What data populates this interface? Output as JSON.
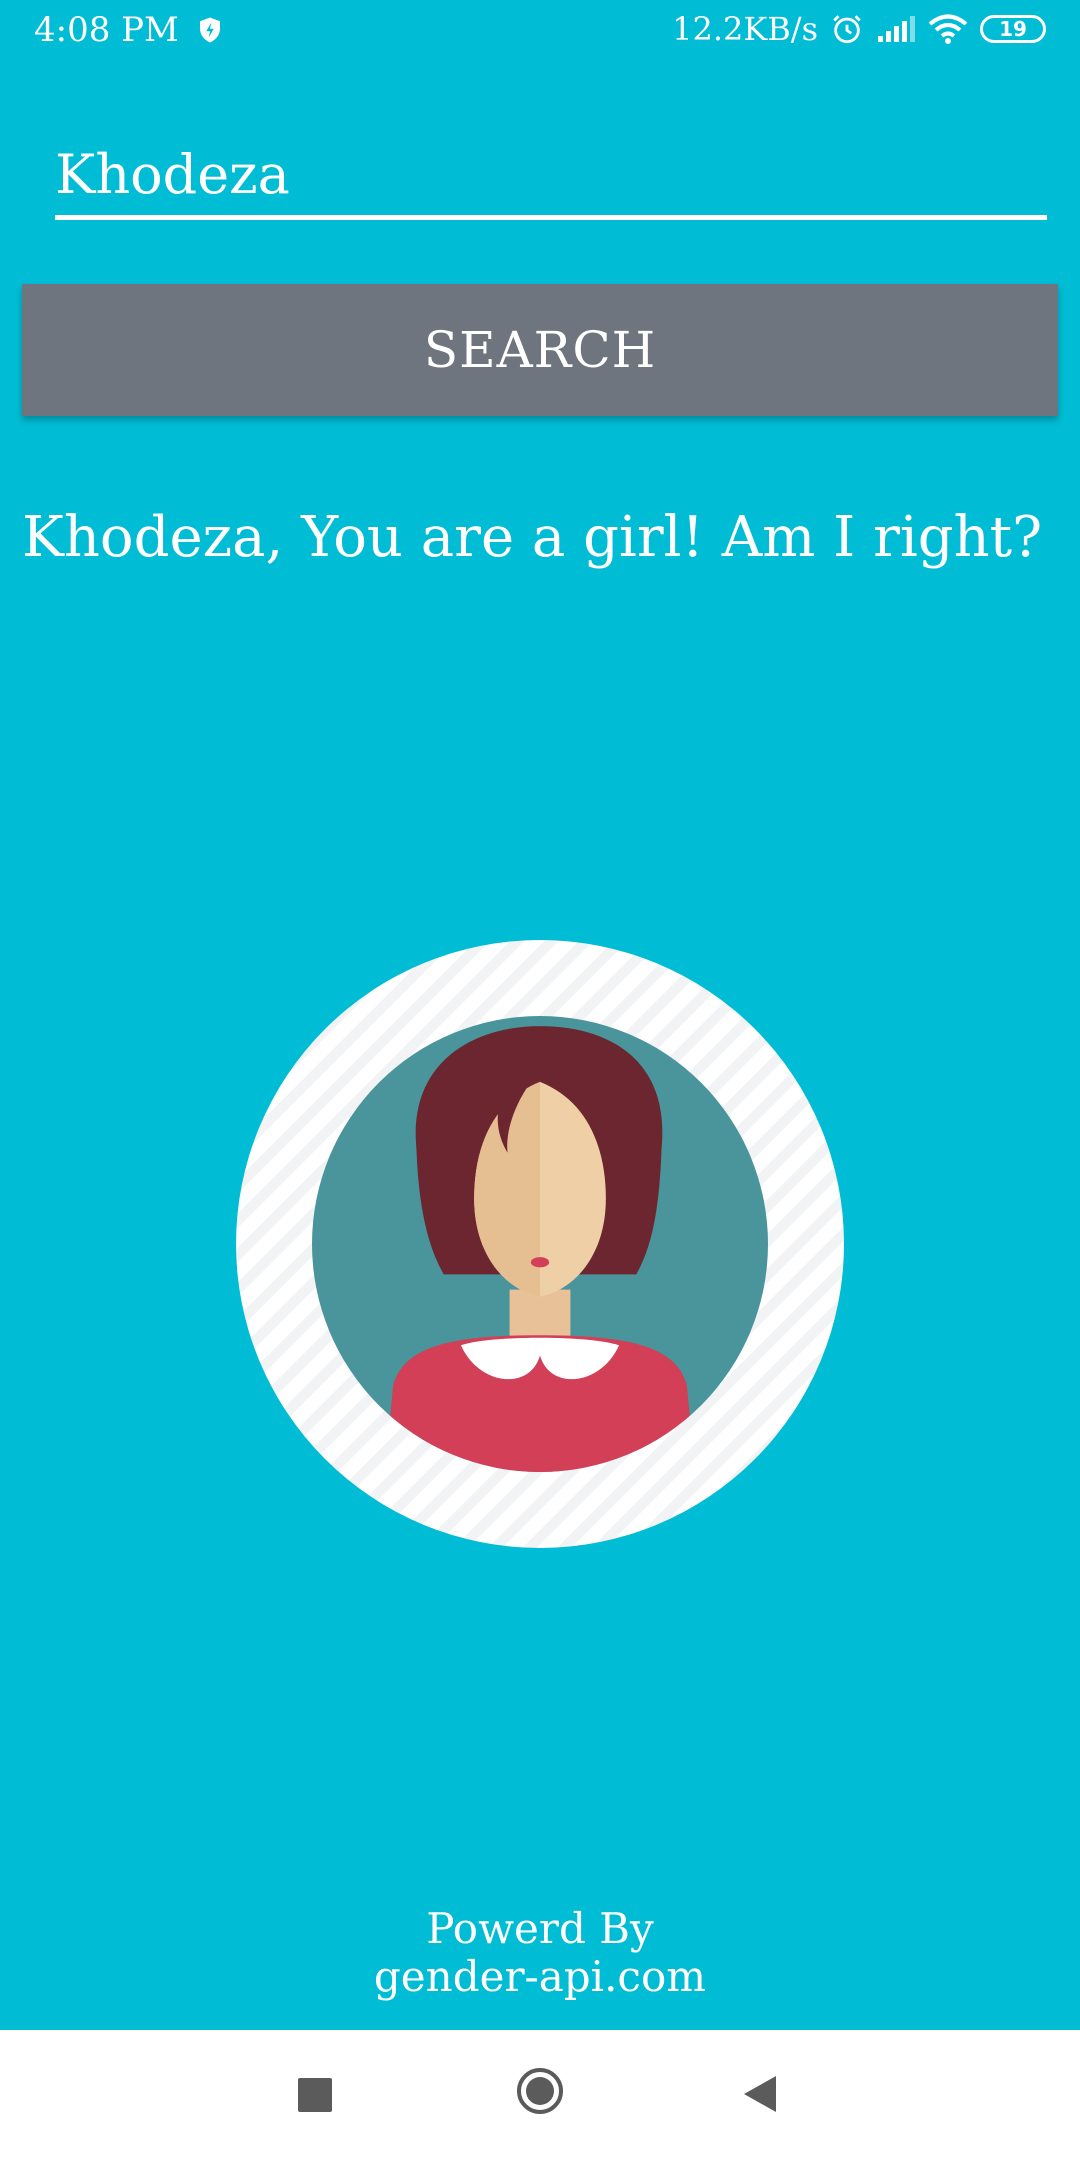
{
  "status_bar": {
    "time": "4:08 PM",
    "speed": "12.2KB/s",
    "battery": "19",
    "icons": [
      "shield-icon",
      "alarm-icon",
      "signal-icon",
      "wifi-icon",
      "battery-icon"
    ]
  },
  "search": {
    "value": "Khodeza",
    "button_label": "SEARCH"
  },
  "result": {
    "message": "Khodeza, You are a girl! Am I right?",
    "avatar": "girl-avatar-icon"
  },
  "footer": {
    "line1": "Powerd By",
    "line2": "gender-api.com"
  },
  "nav_bar": {
    "icons": [
      "recents-icon",
      "home-icon",
      "back-icon"
    ]
  },
  "colors": {
    "background": "#00BCD4",
    "button": "#6E757F",
    "avatar_ring": "#4A949C",
    "hair": "#6B2630",
    "dress": "#D23F57"
  }
}
